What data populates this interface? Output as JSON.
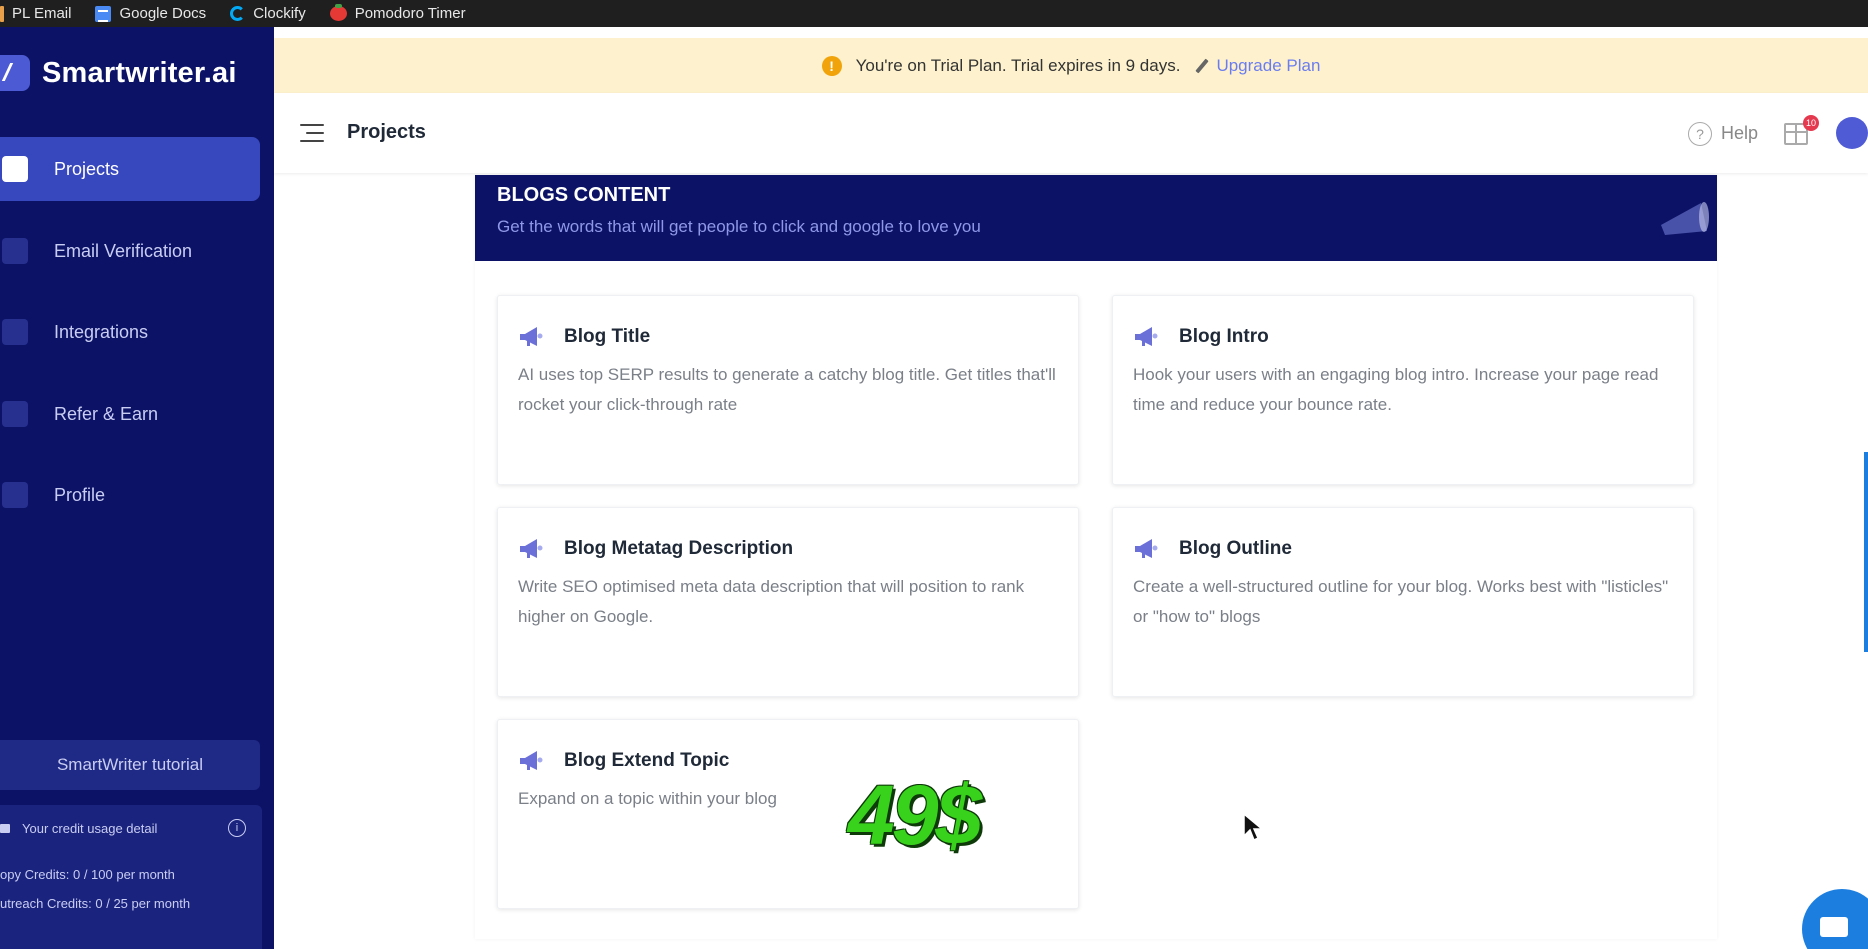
{
  "bookmarks": [
    {
      "label": "PL Email",
      "icon": "pl-email-icon"
    },
    {
      "label": "Google Docs",
      "icon": "google-docs-icon"
    },
    {
      "label": "Clockify",
      "icon": "clockify-icon"
    },
    {
      "label": "Pomodoro Timer",
      "icon": "pomodoro-timer-icon"
    }
  ],
  "sidebar": {
    "logo": "Smartwriter.ai",
    "items": [
      {
        "label": "Projects",
        "icon": "folder-icon",
        "active": true
      },
      {
        "label": "Email Verification",
        "icon": "bolt-icon"
      },
      {
        "label": "Integrations",
        "icon": "gear-icon"
      },
      {
        "label": "Refer & Earn",
        "icon": "gift-card-icon"
      },
      {
        "label": "Profile",
        "icon": "user-icon"
      }
    ],
    "tutorial_label": "SmartWriter tutorial",
    "credits": {
      "heading": "Your credit usage detail",
      "copy": "opy Credits: 0 / 100 per month",
      "outreach": "utreach Credits: 0 / 25 per month"
    }
  },
  "banner": {
    "message": "You're on Trial Plan. Trial expires in 9 days.",
    "link": "Upgrade Plan"
  },
  "header": {
    "title": "Projects",
    "help": "Help",
    "gift_badge": "10"
  },
  "section": {
    "title": "BLOGS CONTENT",
    "subtitle": "Get the words that will get people to click and google to love you"
  },
  "cards": [
    {
      "title": "Blog Title",
      "desc": "AI uses top SERP results to generate a catchy blog title. Get titles that'll rocket your click-through rate"
    },
    {
      "title": "Blog Intro",
      "desc": "Hook your users with an engaging blog intro. Increase your page read time and reduce your bounce rate."
    },
    {
      "title": "Blog Metatag Description",
      "desc": "Write SEO optimised meta data description that will position to rank higher on Google."
    },
    {
      "title": "Blog Outline",
      "desc": "Create a well-structured outline for your blog. Works best with \"listicles\" or \"how to\" blogs"
    },
    {
      "title": "Blog Extend Topic",
      "desc": "Expand on a topic within your blog"
    }
  ],
  "overlay_price": "49$",
  "colors": {
    "sidebar_bg": "#0c1367",
    "active_nav": "#3747bd",
    "banner_bg": "#fdf2cd",
    "link": "#6b7cf0",
    "price_green": "#38d11c"
  }
}
